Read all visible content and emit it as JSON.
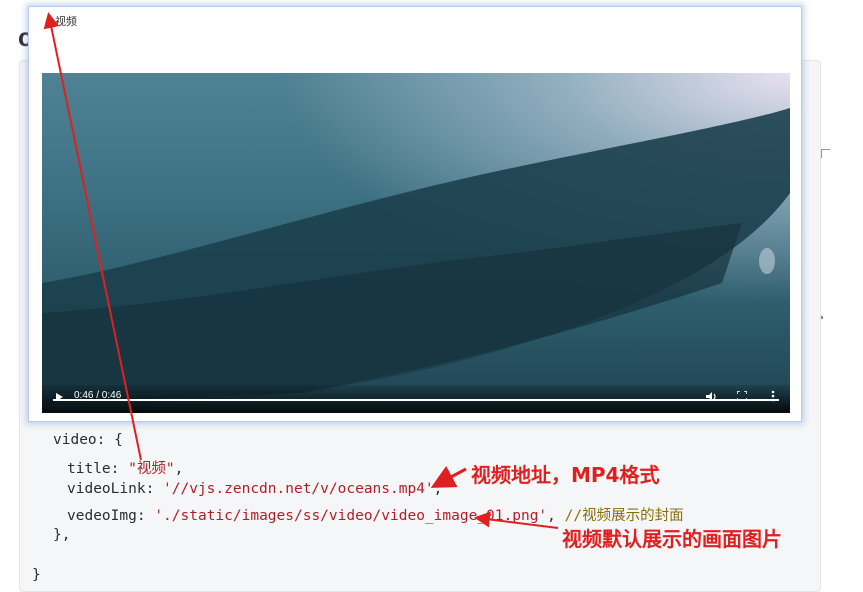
{
  "page": {
    "heading_char": "c"
  },
  "modal": {
    "title": "视频"
  },
  "player": {
    "time_display": "0:46 / 0:46",
    "progress_fraction": 1.0,
    "controls": {
      "play_icon": "play-icon",
      "volume_icon": "volume-icon",
      "fullscreen_icon": "fullscreen-icon",
      "more_icon": "more-options-icon"
    }
  },
  "code": {
    "line_prev": "},",
    "video_open": "video: {",
    "title_key": "title: ",
    "title_value": "\"视频\"",
    "link_key": "videoLink: ",
    "link_value": "'//vjs.zencdn.net/v/oceans.mp4'",
    "img_key": "vedeoImg: ",
    "img_value": "'./static/images/ss/video/video_image_01.png'",
    "img_comment": "//视频展示的封面",
    "close_inner": "},",
    "close_outer": "}"
  },
  "annotations": {
    "video_link_note": "视频地址，MP4格式",
    "video_image_note": "视频默认展示的画面图片"
  },
  "colors": {
    "annotation": "#e02020",
    "string": "#b31d28",
    "comment": "#8a6d0b"
  }
}
